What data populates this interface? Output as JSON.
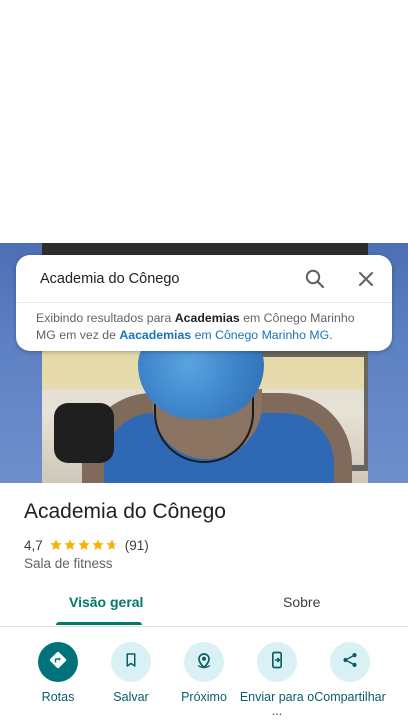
{
  "search": {
    "query": "Academia do Cônego",
    "note_prefix": "Exibindo resultados para ",
    "note_term": "Academias",
    "note_middle": " em Cônego Marinho MG em vez de ",
    "note_original": "Aacademias",
    "note_original_location": " em Cônego Marinho MG",
    "note_end": "."
  },
  "place": {
    "title": "Academia do Cônego",
    "rating": "4,7",
    "rating_stars": 4.7,
    "review_count": "(91)",
    "category": "Sala de fitness"
  },
  "tabs": [
    {
      "label": "Visão geral",
      "active": true
    },
    {
      "label": "Sobre",
      "active": false
    }
  ],
  "actions": [
    {
      "label": "Rotas",
      "icon": "directions-icon"
    },
    {
      "label": "Salvar",
      "icon": "bookmark-icon"
    },
    {
      "label": "Próximo",
      "icon": "nearby-icon"
    },
    {
      "label": "Enviar para o ...",
      "icon": "send-to-phone-icon"
    },
    {
      "label": "Compartilhar",
      "icon": "share-icon"
    }
  ],
  "colors": {
    "accent": "#00796b",
    "primary_button": "#00727a",
    "secondary_button": "#d9f1f4",
    "star": "#f4b400"
  }
}
